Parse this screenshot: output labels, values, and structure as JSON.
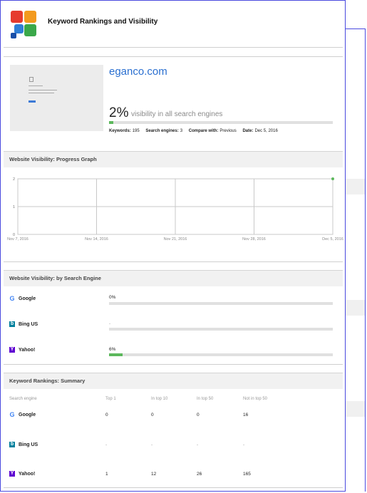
{
  "header": {
    "title": "Keyword Rankings and Visibility"
  },
  "site": {
    "domain": "eganco.com",
    "visibility_percent": "2%",
    "visibility_value": 2,
    "visibility_label": "visibility in all search engines",
    "thumb_caption": "This site can't be reached"
  },
  "meta": {
    "keywords_label": "Keywords:",
    "keywords_value": "195",
    "engines_label": "Search engines:",
    "engines_value": "3",
    "compare_label": "Compare with:",
    "compare_value": "Previous",
    "date_label": "Date:",
    "date_value": "Dec 5, 2016"
  },
  "progress_section": {
    "title": "Website Visibility: Progress Graph"
  },
  "chart_data": {
    "type": "line",
    "x_ticks": [
      "Nov 7, 2016",
      "Nov 14, 2016",
      "Nov 21, 2016",
      "Nov 28, 2016",
      "Dec 5, 2016"
    ],
    "y_ticks": [
      "0",
      "1",
      "2"
    ],
    "ylim": [
      0,
      2
    ],
    "series": [
      {
        "points": [
          {
            "x": "Dec 5, 2016",
            "y": 2
          }
        ],
        "color": "#5cb85c"
      }
    ],
    "grid": true
  },
  "engines_section": {
    "title": "Website Visibility: by Search Engine",
    "engines": [
      {
        "name": "Google",
        "value_text": "0%",
        "value": 0,
        "icon": "google-icon"
      },
      {
        "name": "Bing US",
        "value_text": "-",
        "value": 0,
        "icon": "bing-icon"
      },
      {
        "name": "Yahoo!",
        "value_text": "6%",
        "value": 6,
        "icon": "yahoo-icon"
      }
    ]
  },
  "summary_section": {
    "title": "Keyword Rankings: Summary",
    "columns": [
      "Search engine",
      "Top 1",
      "In top 10",
      "In top 50",
      "Not in top 50"
    ],
    "rows": [
      {
        "engine": "Google",
        "cells": [
          "0",
          "0",
          "0",
          "16"
        ]
      },
      {
        "engine": "Bing US",
        "cells": [
          "-",
          "-",
          "-",
          "-"
        ]
      },
      {
        "engine": "Yahoo!",
        "cells": [
          "1",
          "12",
          "26",
          "165"
        ]
      }
    ]
  },
  "colors": {
    "accent": "#2a6fd0",
    "green": "#5cb85c",
    "border": "#4a4adf"
  }
}
